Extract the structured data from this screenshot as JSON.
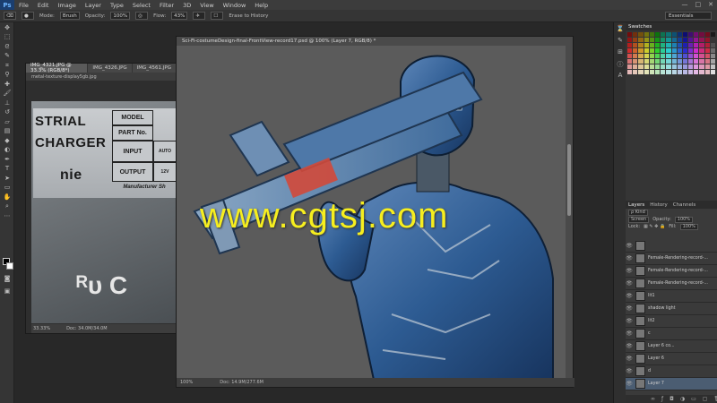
{
  "app": {
    "logo": "Ps"
  },
  "menu": [
    "File",
    "Edit",
    "Image",
    "Layer",
    "Type",
    "Select",
    "Filter",
    "3D",
    "View",
    "Window",
    "Help"
  ],
  "window_controls": [
    "—",
    "□",
    "✕"
  ],
  "options": {
    "mode_label": "Mode:",
    "mode_value": "Brush",
    "opacity_label": "Opacity:",
    "opacity_value": "100%",
    "flow_label": "Flow:",
    "flow_value": "43%",
    "erase_history": "Erase to History",
    "workspace": "Essentials"
  },
  "doc_left": {
    "tabs": [
      "IMG_4321.JPG @ 33.3% (RGB/8*)",
      "IMG_4326.JPG",
      "IMG_4561.JPG"
    ],
    "subtab": "metal-texture-display5gb.jpg",
    "label_texts": {
      "line1": "STRIAL",
      "line2": "CHARGER",
      "model": "MODEL",
      "part": "PART No.",
      "input": "INPUT",
      "output": "OUTPUT",
      "brand": "nie",
      "mfr": "Manufacturer Sh",
      "ul": "ᴿᴜ C",
      "auto": "AUTO",
      "volt": "12V"
    },
    "zoom": "33.33%",
    "doc_size": "Doc: 34.0M/34.0M"
  },
  "doc_main": {
    "title": "Sci-Fi-costumeDesign-final-FrontView-record17.psd @ 100% (Layer 7, RGB/8) *",
    "zoom": "100%",
    "doc_size": "Doc: 14.9M/277.6M"
  },
  "watermark": "www.cgtsj.com",
  "panels": {
    "swatches_tabs": [
      "Swatches"
    ],
    "layers_tabs": [
      "Layers",
      "History",
      "Channels"
    ],
    "kind": "ρ Kind",
    "blend": "Screen",
    "opacity_label": "Opacity:",
    "opacity_value": "100%",
    "lock_label": "Lock:",
    "fill_label": "Fill:",
    "fill_value": "100%",
    "layers": [
      {
        "name": "",
        "sel": false
      },
      {
        "name": "Female-Rendering-record-...",
        "sel": false
      },
      {
        "name": "Female-Rendering-record-...",
        "sel": false
      },
      {
        "name": "Female-Rendering-record-...",
        "sel": false
      },
      {
        "name": "lit1",
        "sel": false
      },
      {
        "name": "shadow light",
        "sel": false
      },
      {
        "name": "lit2",
        "sel": false
      },
      {
        "name": "c",
        "sel": false
      },
      {
        "name": "Layer 6 co...",
        "sel": false
      },
      {
        "name": "Layer 6",
        "sel": false
      },
      {
        "name": "d",
        "sel": false
      },
      {
        "name": "Layer 7",
        "sel": true
      }
    ]
  },
  "colors": {
    "accent": "#f6ee1f",
    "selection": "#4b5d72"
  }
}
